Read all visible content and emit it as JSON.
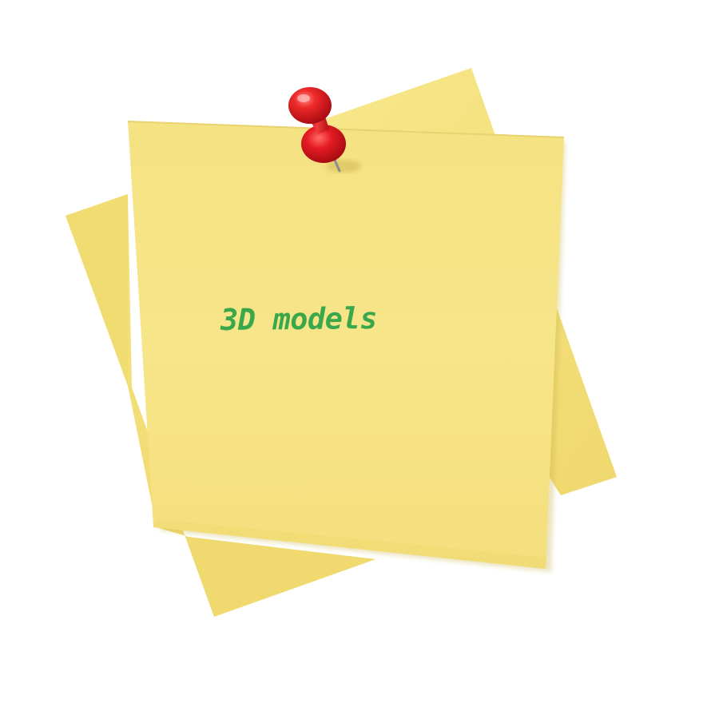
{
  "note": {
    "text": "3D models",
    "text_color": "#3aa84a"
  },
  "colors": {
    "paper": "#f6e484",
    "paper_shade": "#f2dc72",
    "pin": "#e0161e"
  },
  "icons": {
    "pin": "pushpin-icon"
  }
}
